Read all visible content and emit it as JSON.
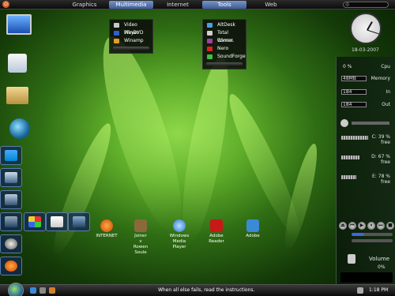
{
  "top_menu": {
    "items": [
      "Graphics",
      "Multimedia",
      "Internet",
      "Tools",
      "Web"
    ],
    "search_placeholder": "◎"
  },
  "multimedia_menu": {
    "items": [
      {
        "label": "Video Player",
        "icon": "video-player-icon",
        "color": "#c8c8c8"
      },
      {
        "label": "WinDVD",
        "icon": "windvd-icon",
        "color": "#3060d0"
      },
      {
        "label": "Winamp",
        "icon": "winamp-icon",
        "color": "#e0a020"
      }
    ]
  },
  "tools_menu": {
    "items": [
      {
        "label": "AltDesk",
        "icon": "altdesk-icon",
        "color": "#4aa0e0"
      },
      {
        "label": "Total Comm.",
        "icon": "totalcmd-icon",
        "color": "#d0d0d0"
      },
      {
        "label": "Winrar",
        "icon": "winrar-icon",
        "color": "#a040a0"
      },
      {
        "label": "Nero",
        "icon": "nero-icon",
        "color": "#e02020"
      },
      {
        "label": "SoundForge",
        "icon": "soundforge-icon",
        "color": "#40c040"
      }
    ]
  },
  "shortcuts": [
    {
      "label": "INTERNET",
      "icon": "firefox-icon",
      "color": "#e07020"
    },
    {
      "label": "Joiner\nv\nRowen\nSoule",
      "icon": "joiner-icon",
      "color": "#8a6a3a"
    },
    {
      "label": "Windows\nMedia\nPlayer",
      "icon": "media-player-icon",
      "color": "#3a7ad0"
    },
    {
      "label": "Adobe\nReader",
      "icon": "adobe-reader-icon",
      "color": "#c81818"
    },
    {
      "label": "Adobe",
      "icon": "adobe-icon",
      "color": "#3a8ad8"
    }
  ],
  "clock": {
    "date": "18-03-2007"
  },
  "stats": {
    "cpu": {
      "value": "0 %",
      "label": "Cpu"
    },
    "memory": {
      "value": "48MB",
      "label": "Memory"
    },
    "in": {
      "value": "184",
      "label": "In"
    },
    "out": {
      "value": "184",
      "label": "Out"
    }
  },
  "drives": [
    {
      "label": "C:",
      "percent": "39 %",
      "suffix": "free",
      "fill": 0.39
    },
    {
      "label": "D:",
      "percent": "67 %",
      "suffix": "free",
      "fill": 0.67
    },
    {
      "label": "E:",
      "percent": "78 %",
      "suffix": "free",
      "fill": 0.78
    }
  ],
  "volume": {
    "label": "Volume",
    "value": "0%"
  },
  "taskbar": {
    "message": "When all else fails, read the instructions.",
    "time": "1:18 PM"
  }
}
